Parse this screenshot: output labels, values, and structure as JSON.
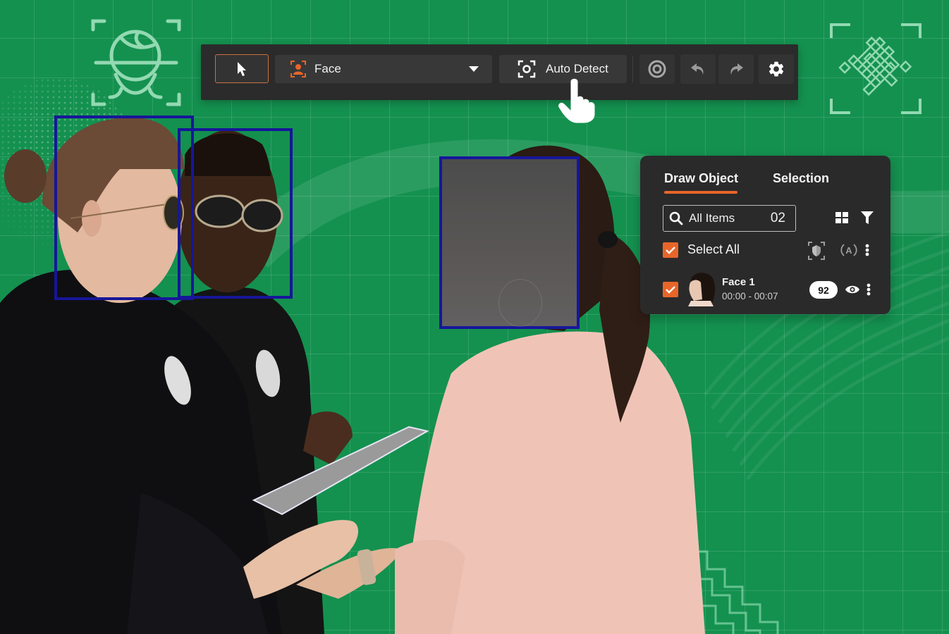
{
  "toolbar": {
    "select_tool": "pointer-select",
    "object_type": "Face",
    "auto_detect_label": "Auto Detect",
    "actions": [
      "target",
      "undo",
      "redo",
      "settings"
    ]
  },
  "panel": {
    "tabs": [
      {
        "label": "Draw Object",
        "active": true
      },
      {
        "label": "Selection",
        "active": false
      }
    ],
    "search": {
      "label": "All Items",
      "count": "02"
    },
    "select_all": {
      "label": "Select All",
      "checked": true
    },
    "items": [
      {
        "title": "Face 1",
        "time_range": "00:00 - 00:07",
        "score": "92",
        "checked": true,
        "visible": true
      }
    ]
  },
  "face_boxes": [
    {
      "label": "face-officer-woman",
      "blurred": false
    },
    {
      "label": "face-officer-man",
      "blurred": false
    },
    {
      "label": "face-civilian-woman",
      "blurred": true
    }
  ],
  "colors": {
    "background": "#14914f",
    "accent": "#e8652a",
    "box_border": "#17169a",
    "panel": "#2a2a2a",
    "toolbar": "#2b2b2b"
  }
}
